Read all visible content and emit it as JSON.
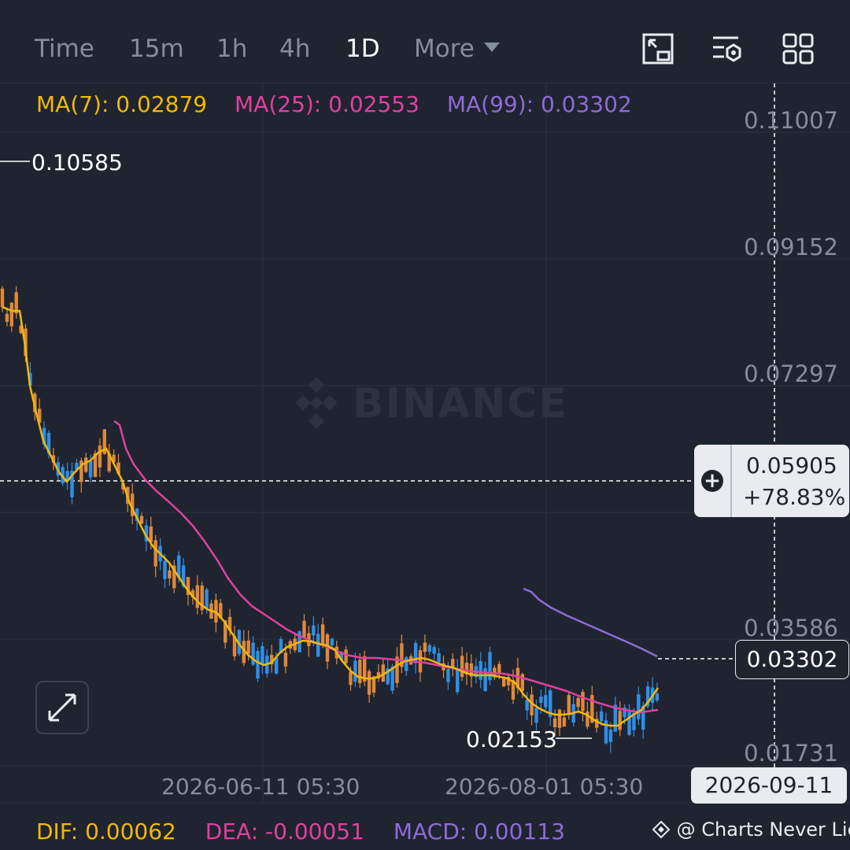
{
  "toolbar": {
    "tabs": [
      "Time",
      "15m",
      "1h",
      "4h",
      "1D"
    ],
    "active_tab": "1D",
    "more_label": "More",
    "icons": [
      "chart-indicator-icon",
      "settings-icon",
      "layout-grid-icon"
    ]
  },
  "legend": {
    "ma7": "MA(7): 0.02879",
    "ma25": "MA(25): 0.02553",
    "ma99": "MA(99): 0.03302"
  },
  "price_axis": [
    "0.11007",
    "0.09152",
    "0.07297",
    "0.03586",
    "0.01731"
  ],
  "markers": {
    "high": "0.10585",
    "low": "0.02153"
  },
  "current_price": {
    "value": "0.05905",
    "change": "+78.83%"
  },
  "ma99_value": "0.03302",
  "time_axis": [
    "2026-06-11 05:30",
    "2026-08-01 05:30"
  ],
  "crosshair_date": "2026-09-11",
  "macd_legend": {
    "dif": "DIF: 0.00062",
    "dea": "DEA: -0.00051",
    "macd": "MACD: 0.00113"
  },
  "watermark": "BINANCE",
  "credit": "@ Charts Never Lie",
  "colors": {
    "background": "#1f2430",
    "up": "#2f8fe6",
    "down": "#e0883a",
    "ma7": "#f0b90b",
    "ma25": "#e040a0",
    "ma99": "#8e6bd6",
    "grid": "#2c3240",
    "axis_text": "#848e9c"
  },
  "chart_data": {
    "type": "candlestick",
    "interval": "1D",
    "y_axis_ticks": [
      0.11007,
      0.09152,
      0.07297,
      0.03586,
      0.01731
    ],
    "ylim": [
      0.01731,
      0.11007
    ],
    "high_marker": 0.10585,
    "low_marker": 0.02153,
    "last_price": 0.05905,
    "change_percent": 78.83,
    "ma7_close_approx": [
      0.085,
      0.075,
      0.06,
      0.052,
      0.05,
      0.047,
      0.043,
      0.04,
      0.036,
      0.034,
      0.031,
      0.03,
      0.031,
      0.029,
      0.03,
      0.031,
      0.03,
      0.029,
      0.027,
      0.025,
      0.024,
      0.023,
      0.0245,
      0.02879
    ],
    "ma25_approx": [
      0.055,
      0.05,
      0.046,
      0.042,
      0.039,
      0.036,
      0.033,
      0.031,
      0.03,
      0.03,
      0.029,
      0.028,
      0.0265,
      0.025,
      0.02553
    ],
    "ma99_approx": [
      0.04,
      0.037,
      0.0355,
      0.03302
    ]
  }
}
